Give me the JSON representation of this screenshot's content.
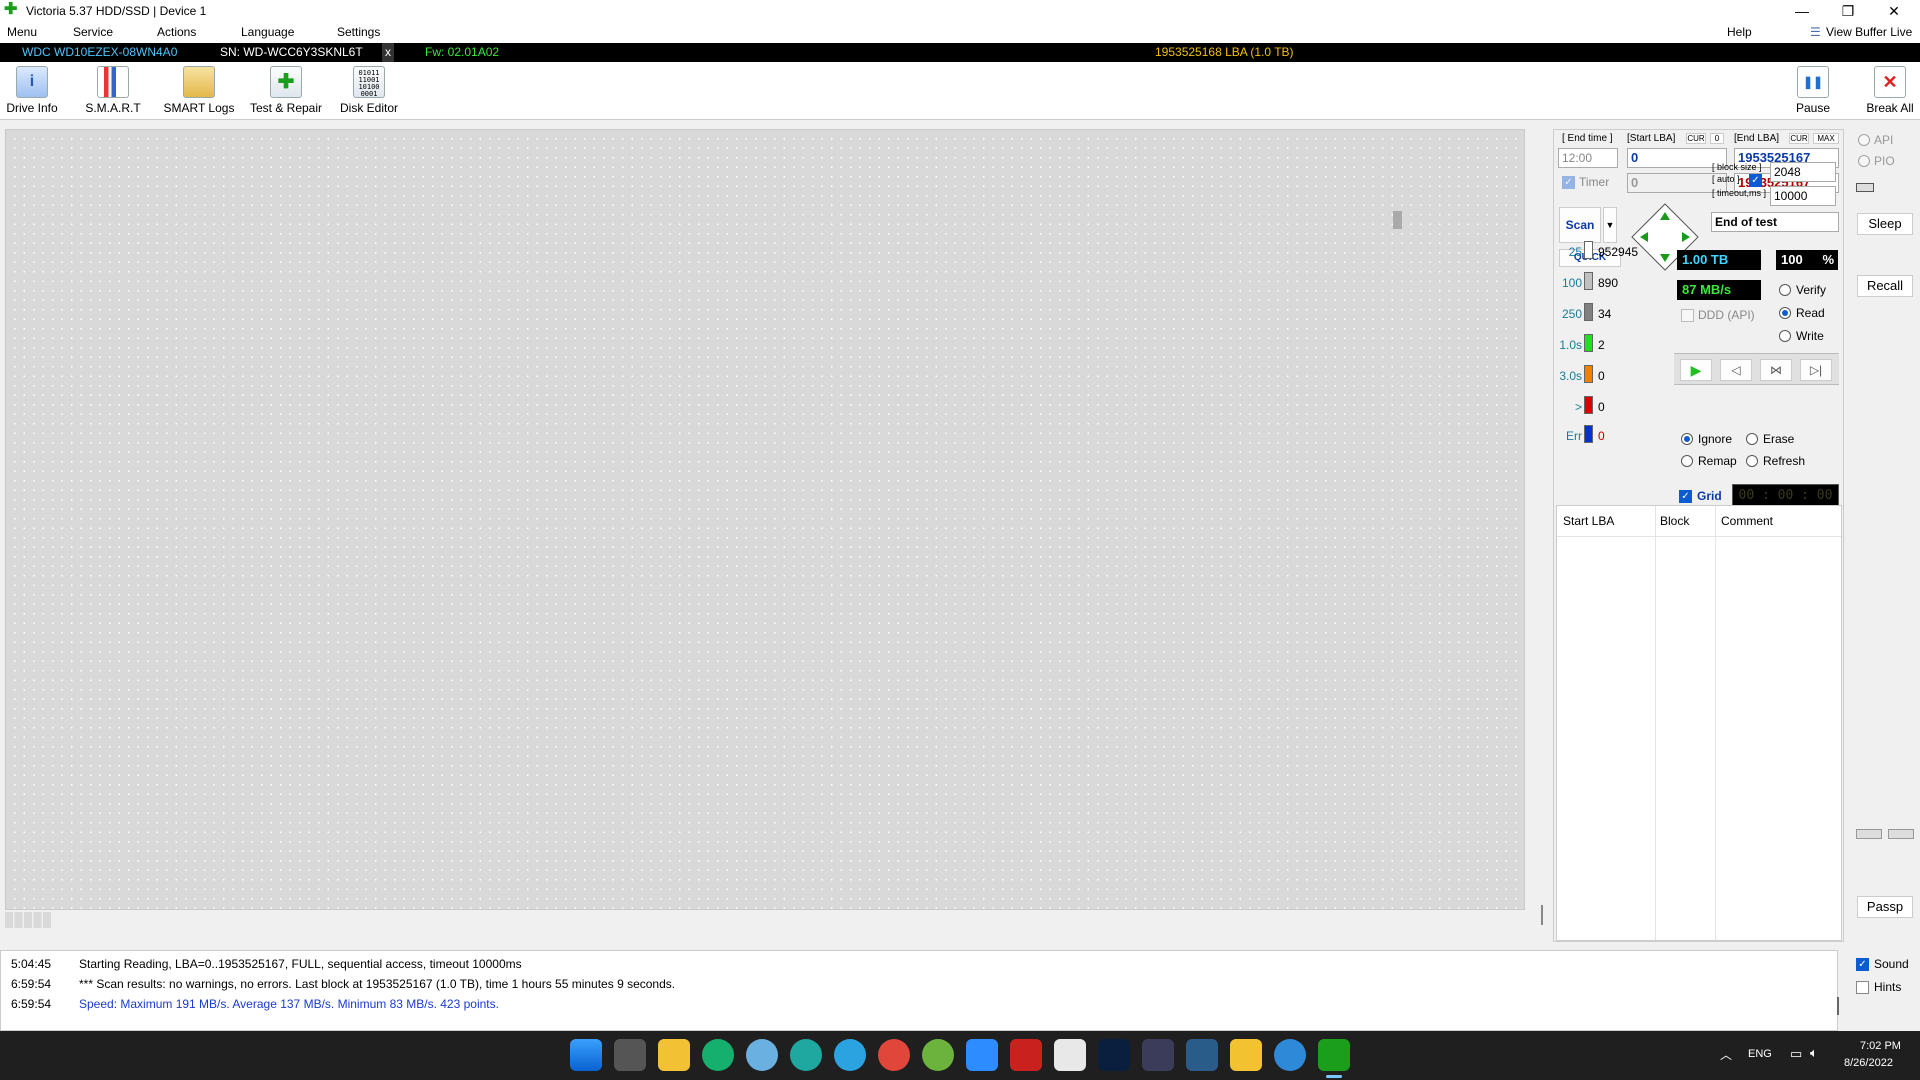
{
  "window": {
    "title": "Victoria 5.37 HDD/SSD | Device 1",
    "min": "—",
    "max": "❐",
    "close": "✕"
  },
  "menu": [
    "Menu",
    "Service",
    "Actions",
    "Language",
    "Settings"
  ],
  "menu_right": {
    "help": "Help",
    "view_buffer": "View Buffer Live"
  },
  "infobar": {
    "model": "WDC WD10EZEX-08WN4A0",
    "serial": "SN: WD-WCC6Y3SKNL6T",
    "close": "x",
    "firmware": "Fw: 02.01A02",
    "lba": "1953525168 LBA (1.0 TB)"
  },
  "toolbar": {
    "drive_info": "Drive Info",
    "smart": "S.M.A.R.T",
    "smart_logs": "SMART Logs",
    "test_repair": "Test & Repair",
    "disk_editor": "Disk Editor",
    "pause": "Pause",
    "break_all": "Break All"
  },
  "panel": {
    "end_time_label": "[ End time ]",
    "start_lba_label": "[Start LBA]",
    "cur": "CUR",
    "zero": "0",
    "end_lba_label": "[End LBA]",
    "max": "MAX",
    "end_time": "12:00",
    "start_lba": "0",
    "end_lba": "1953525167",
    "timer_label": "Timer",
    "timer_value": "0",
    "end_lba2": "1953525167",
    "scan": "Scan",
    "quick": "QUICK",
    "block_size_label": "[ block size ]",
    "auto_label": "[ auto ]",
    "timeout_label": "[ timeout,ms ]",
    "block_size": "2048",
    "timeout": "10000",
    "end_mode": "End of test"
  },
  "stats": [
    {
      "label": "25",
      "count": "952945",
      "color": "#ffffff",
      "label_color": "#1a7a9a"
    },
    {
      "label": "100",
      "count": "890",
      "color": "#c0c0c0",
      "label_color": "#1a7a9a"
    },
    {
      "label": "250",
      "count": "34",
      "color": "#808080",
      "label_color": "#1a7a9a"
    },
    {
      "label": "1.0s",
      "count": "2",
      "color": "#22dd22",
      "label_color": "#1a7a9a"
    },
    {
      "label": "3.0s",
      "count": "0",
      "color": "#f08000",
      "label_color": "#1a7a9a"
    },
    {
      "label": ">",
      "count": "0",
      "color": "#e00000",
      "label_color": "#1a7a9a"
    },
    {
      "label": "Err",
      "count": "0",
      "color": "#0033cc",
      "label_color": "#1a7a9a"
    }
  ],
  "readouts": {
    "size": "1.00 TB",
    "percent": "100",
    "percent_sign": "%",
    "speed": "87 MB/s",
    "ddd": "DDD (API)"
  },
  "modes": {
    "verify": "Verify",
    "read": "Read",
    "write": "Write"
  },
  "actions": {
    "ignore": "Ignore",
    "erase": "Erase",
    "remap": "Remap",
    "refresh": "Refresh",
    "grid": "Grid",
    "clock": "00 : 00 : 00"
  },
  "list": {
    "col_start": "Start LBA",
    "col_block": "Block",
    "col_comment": "Comment"
  },
  "side": {
    "api": "API",
    "pio": "PIO",
    "sleep": "Sleep",
    "recall": "Recall",
    "passp": "Passp",
    "sound": "Sound",
    "hints": "Hints"
  },
  "log": [
    {
      "time": "5:04:45",
      "text": "Starting Reading, LBA=0..1953525167, FULL, sequential access, timeout 10000ms",
      "color": "#000000"
    },
    {
      "time": "6:59:54",
      "text": "*** Scan results: no warnings, no errors. Last block at 1953525167 (1.0 TB), time 1 hours 55 minutes 9 seconds.",
      "color": "#000000"
    },
    {
      "time": "6:59:54",
      "text": "Speed: Maximum 191 MB/s. Average 137 MB/s. Minimum 83 MB/s. 423 points.",
      "color": "#1a3ad0"
    }
  ],
  "taskbar": {
    "lang": "ENG",
    "time": "7:02 PM",
    "date": "8/26/2022"
  }
}
